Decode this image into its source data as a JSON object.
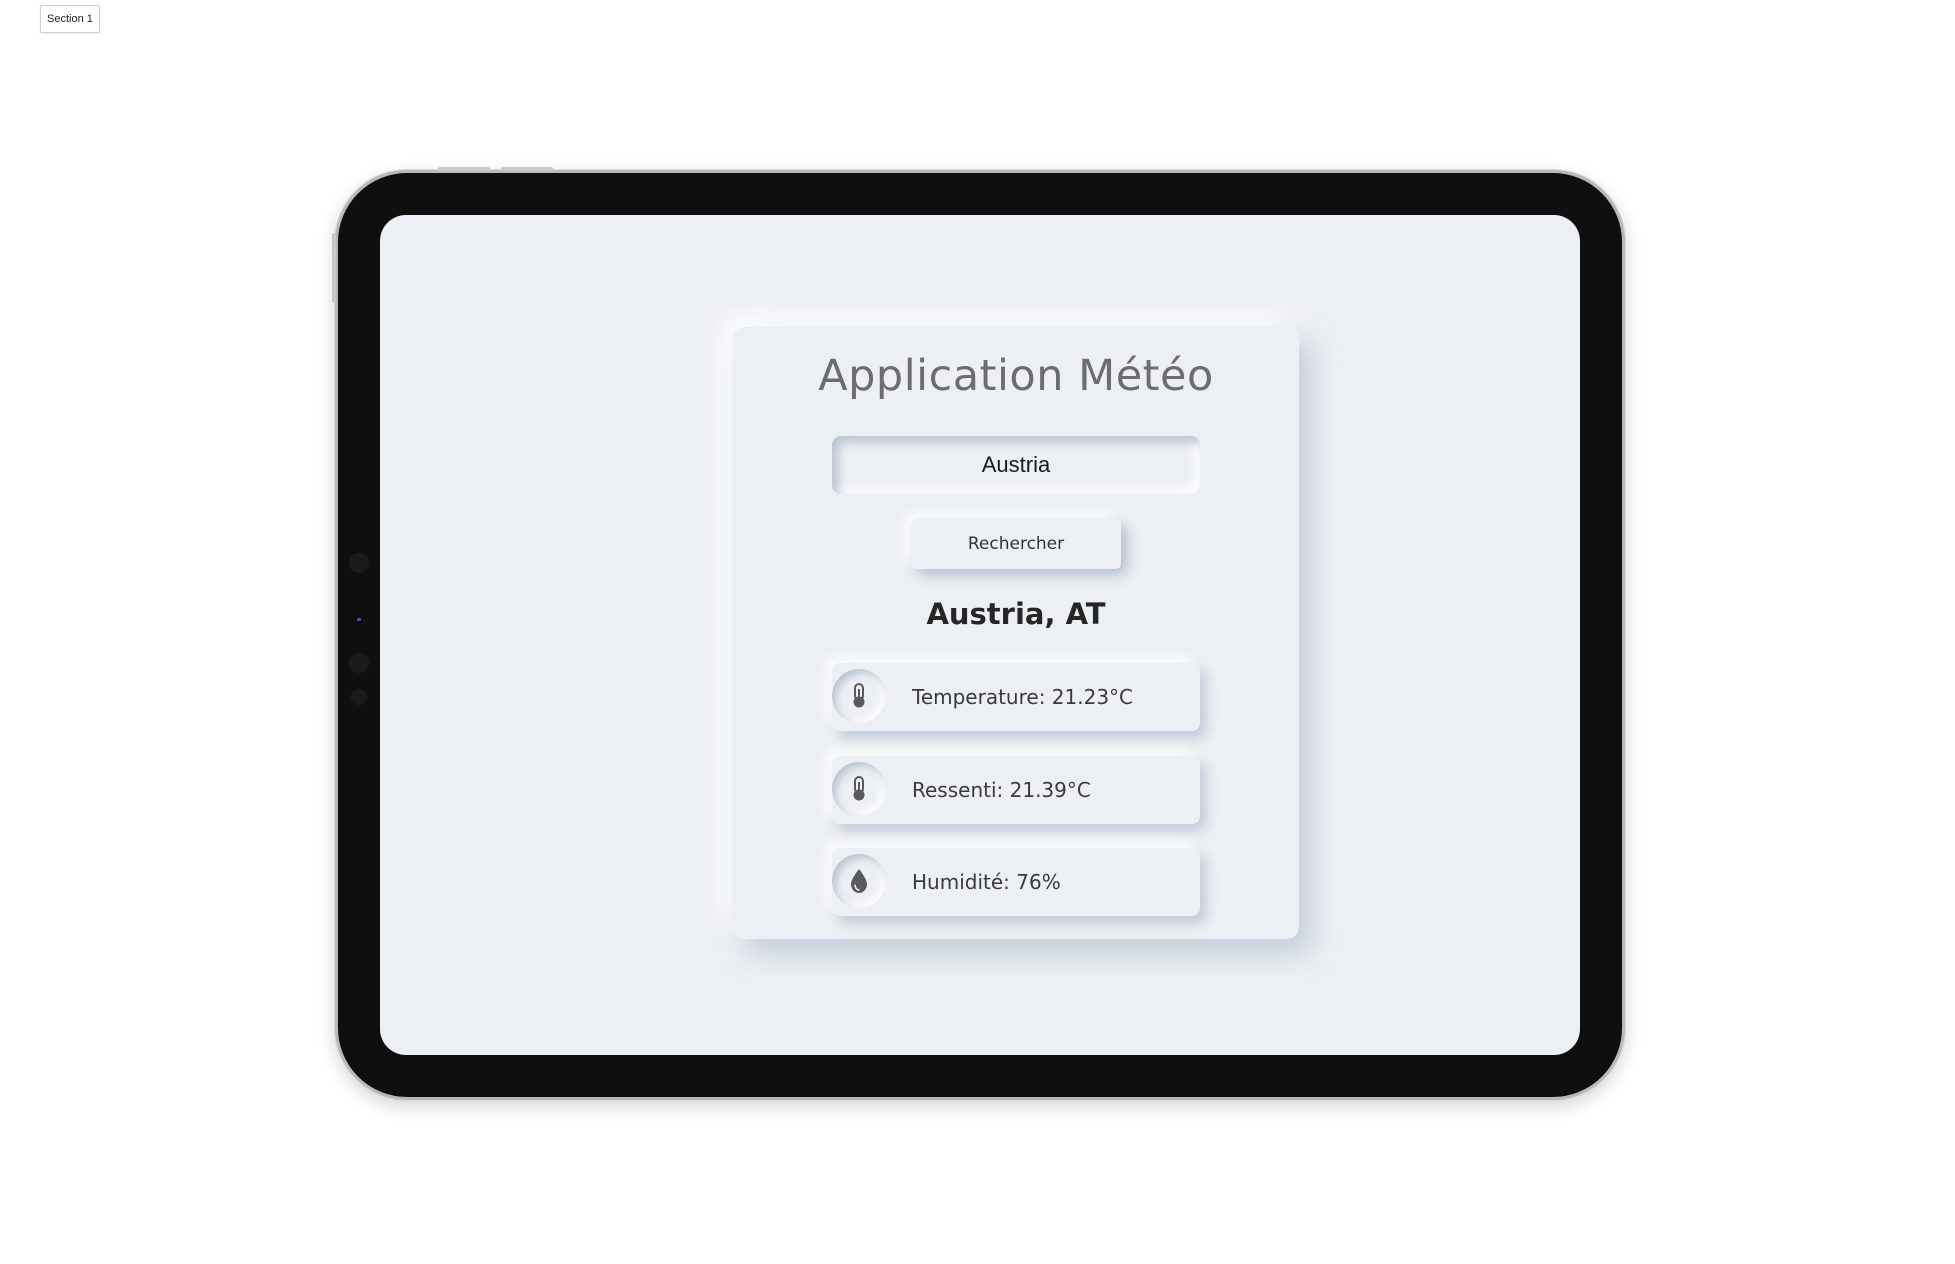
{
  "section_tag": "Section 1",
  "app": {
    "title": "Application Météo"
  },
  "search": {
    "value": "Austria",
    "button_label": "Rechercher"
  },
  "result": {
    "location": "Austria, AT",
    "stats": [
      {
        "icon": "thermometer-icon",
        "text": "Temperature: 21.23°C"
      },
      {
        "icon": "thermometer-icon",
        "text": "Ressenti: 21.39°C"
      },
      {
        "icon": "water-drop-icon",
        "text": "Humidité: 76%"
      }
    ]
  },
  "colors": {
    "background": "#eceff3",
    "title": "#6d6d6d",
    "icon": "#5a5a5a"
  }
}
